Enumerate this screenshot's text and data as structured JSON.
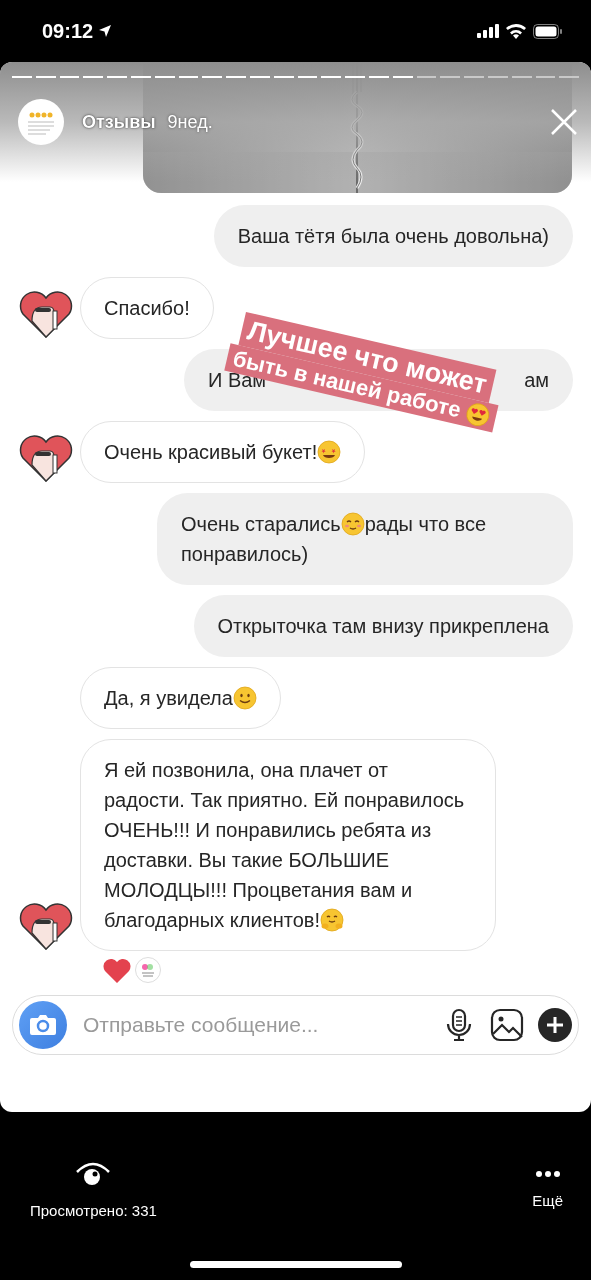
{
  "status_bar": {
    "time": "09:12"
  },
  "story": {
    "progress": [
      {
        "viewed": true
      },
      {
        "viewed": true
      },
      {
        "viewed": true
      },
      {
        "viewed": true
      },
      {
        "viewed": true
      },
      {
        "viewed": true
      },
      {
        "viewed": true
      },
      {
        "viewed": true
      },
      {
        "viewed": true
      },
      {
        "viewed": true
      },
      {
        "viewed": true
      },
      {
        "viewed": true
      },
      {
        "viewed": true
      },
      {
        "viewed": true
      },
      {
        "viewed": true
      },
      {
        "viewed": true
      },
      {
        "viewed": true
      },
      {
        "viewed": false
      },
      {
        "viewed": false
      },
      {
        "viewed": false
      },
      {
        "viewed": false
      },
      {
        "viewed": false
      },
      {
        "viewed": false
      },
      {
        "viewed": false
      }
    ],
    "account": "Отзывы",
    "age": "9нед."
  },
  "messages": [
    {
      "kind": "sent",
      "segments": [
        {
          "kind": "text",
          "text": "Ваша тётя была очень довольна)"
        }
      ]
    },
    {
      "kind": "received",
      "avatar": true,
      "segments": [
        {
          "kind": "text",
          "text": "Спасибо!"
        }
      ]
    },
    {
      "kind": "sent",
      "segments": [
        {
          "kind": "text",
          "text": "И Вам"
        },
        {
          "kind": "covered"
        },
        {
          "kind": "text",
          "text": "ам"
        }
      ]
    },
    {
      "kind": "received",
      "avatar": true,
      "segments": [
        {
          "kind": "text",
          "text": "Очень красивый букет!"
        },
        {
          "kind": "star-eyes"
        }
      ]
    },
    {
      "kind": "sent",
      "segments": [
        {
          "kind": "text",
          "text": "Очень старались"
        },
        {
          "kind": "blush"
        },
        {
          "kind": "text",
          "text": "рады что все понравилось)"
        }
      ]
    },
    {
      "kind": "sent",
      "segments": [
        {
          "kind": "text",
          "text": "Открыточка там внизу прикреплена"
        }
      ]
    },
    {
      "kind": "received",
      "avatar": false,
      "segments": [
        {
          "kind": "text",
          "text": "Да, я увидела"
        },
        {
          "kind": "smile"
        }
      ]
    },
    {
      "kind": "received",
      "avatar": true,
      "segments": [
        {
          "kind": "text",
          "text": "Я ей позвонила, она плачет от радости. Так приятно. Ей понравилось ОЧЕНЬ!!! И понравились ребята из доставки. Вы такие БОЛЬШИЕ МОЛОДЦЫ!!! Процветания вам и благодарных клиентов!"
        },
        {
          "kind": "hug"
        }
      ]
    }
  ],
  "sticker": {
    "lines": [
      "Лучшее что может",
      "быть в нашей работе"
    ]
  },
  "composer": {
    "placeholder": "Отправьте сообщение..."
  },
  "footer": {
    "views": "Просмотрено: 331",
    "more": "Ещё"
  }
}
